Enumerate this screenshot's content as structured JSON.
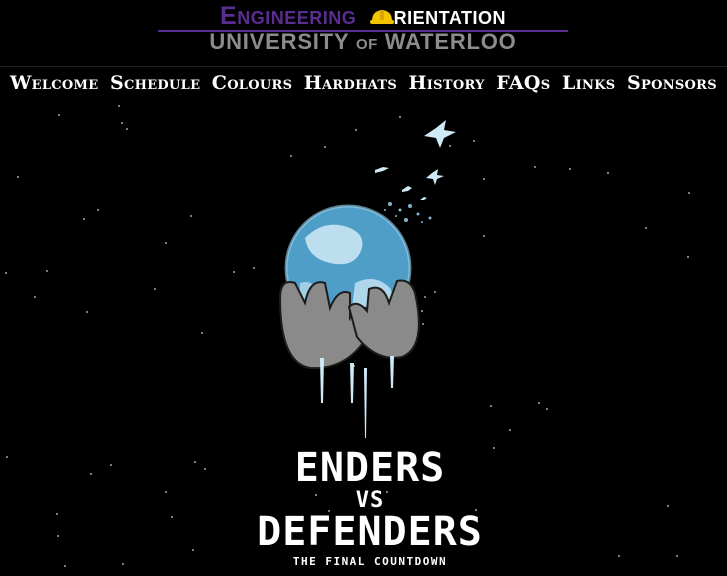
{
  "header": {
    "logo_engineering": "Engineering",
    "logo_orientation": "rientation",
    "logo_university": "UNIVERSITY",
    "logo_of": "OF",
    "logo_waterloo": "WATERLOO"
  },
  "nav": {
    "items": [
      {
        "label": "Welcome"
      },
      {
        "label": "Schedule"
      },
      {
        "label": "Colours"
      },
      {
        "label": "Hardhats"
      },
      {
        "label": "History"
      },
      {
        "label": "FAQs"
      },
      {
        "label": "Links"
      },
      {
        "label": "Sponsors"
      }
    ]
  },
  "hero": {
    "title_line1": "ENDERS",
    "title_line2": "VS",
    "title_line3": "DEFENDERS",
    "subtitle": "THE FINAL COUNTDOWN"
  },
  "colors": {
    "background": "#000000",
    "brand_purple": "#5b2d91",
    "hardhat_yellow": "#f2c500",
    "logo_gray": "#8c8c8c",
    "globe_blue": "#5fb6e0"
  },
  "icons": [
    "hardhat-icon",
    "globe-in-hands-icon",
    "dove-icon"
  ]
}
